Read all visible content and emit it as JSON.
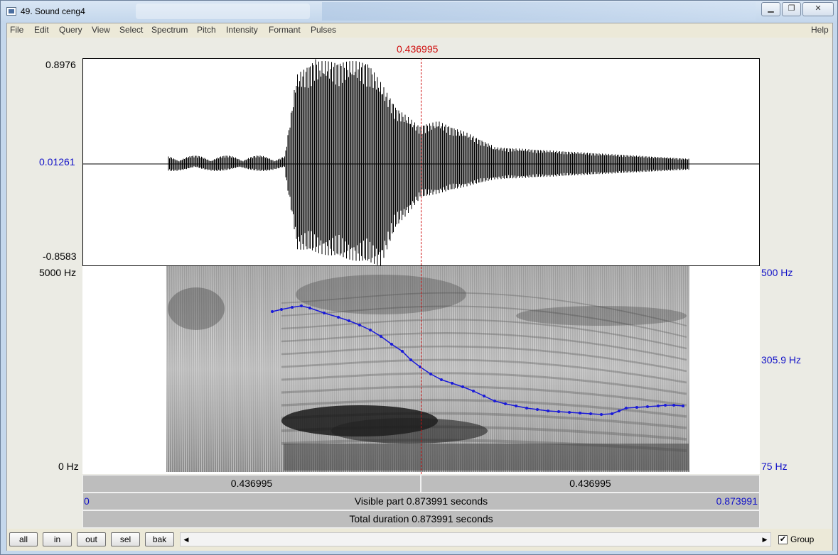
{
  "window": {
    "title": "49. Sound ceng4",
    "controls": [
      "minimize",
      "maximize",
      "close"
    ]
  },
  "menu": [
    "File",
    "Edit",
    "Query",
    "View",
    "Select",
    "Spectrum",
    "Pitch",
    "Intensity",
    "Formant",
    "Pulses",
    "Help"
  ],
  "cursor": {
    "time": "0.436995",
    "fraction": 0.5
  },
  "waveform": {
    "ymax": "0.8976",
    "yzero": "0.01261",
    "ymin": "-0.8583"
  },
  "spectrogram": {
    "fmax": "5000 Hz",
    "fmin": "0 Hz"
  },
  "pitch": {
    "top": "500 Hz",
    "mid": "305.9 Hz",
    "bottom": "75 Hz",
    "color": "#1a1ad8"
  },
  "time_bars": {
    "left_segment": "0.436995",
    "right_segment": "0.436995",
    "visible_start": "0",
    "visible_label": "Visible part 0.873991 seconds",
    "visible_end": "0.873991",
    "total_label": "Total duration 0.873991 seconds"
  },
  "buttons": {
    "all": "all",
    "in": "in",
    "out": "out",
    "sel": "sel",
    "bak": "bak"
  },
  "group": {
    "label": "Group",
    "checked": true,
    "mark": "✔"
  }
}
